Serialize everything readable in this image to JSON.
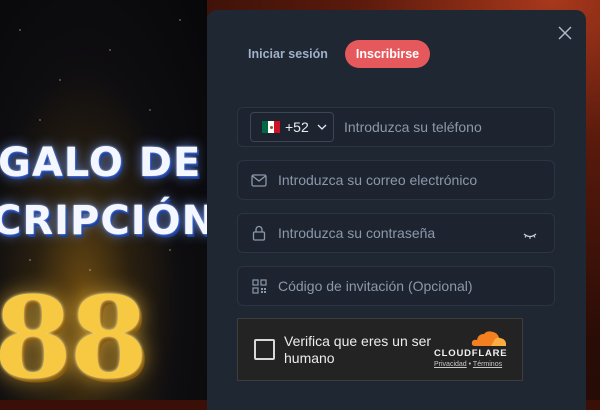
{
  "promo": {
    "line1": "GALO DE",
    "line2": "CRIPCIÓN",
    "number": "88"
  },
  "modal": {
    "tabs": [
      {
        "label": "Iniciar sesión",
        "active": false
      },
      {
        "label": "Inscribirse",
        "active": true
      }
    ],
    "phone": {
      "country_flag": "mexico-flag",
      "prefix": "+52",
      "placeholder": "Introduzca su teléfono"
    },
    "email": {
      "icon": "mail-icon",
      "placeholder": "Introduzca su correo electrónico"
    },
    "password": {
      "icon": "lock-icon",
      "placeholder": "Introduzca su contraseña",
      "toggle_icon": "eye-closed-icon"
    },
    "invite": {
      "icon": "qr-code-icon",
      "placeholder": "Código de invitación (Opcional)"
    },
    "captcha": {
      "label": "Verifica que eres un ser humano",
      "brand": "CLOUDFLARE",
      "privacy": "Privacidad",
      "separator": "•",
      "terms": "Términos"
    }
  },
  "colors": {
    "accent": "#e5585c",
    "panel": "#1f2733",
    "field_border": "#2b3442",
    "placeholder_text": "#8b98aa",
    "cloudflare_orange": "#f38020"
  }
}
